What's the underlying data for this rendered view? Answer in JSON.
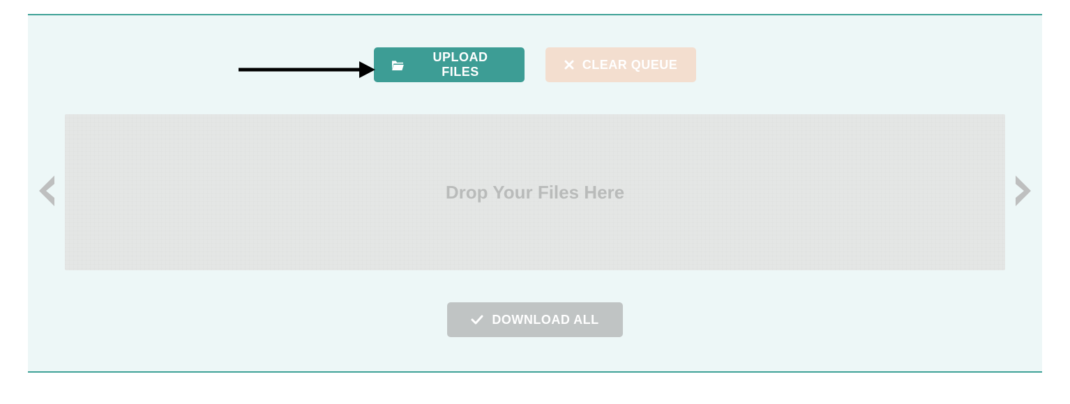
{
  "buttons": {
    "upload_label": "UPLOAD FILES",
    "clear_label": "CLEAR QUEUE",
    "download_label": "DOWNLOAD ALL"
  },
  "dropzone": {
    "placeholder": "Drop Your Files Here"
  },
  "colors": {
    "accent": "#3d9d95",
    "panel_bg": "#edf7f7",
    "clear_bg": "#f3decf",
    "disabled_bg": "#c0c4c4",
    "dropzone_bg": "#e4e6e5"
  }
}
